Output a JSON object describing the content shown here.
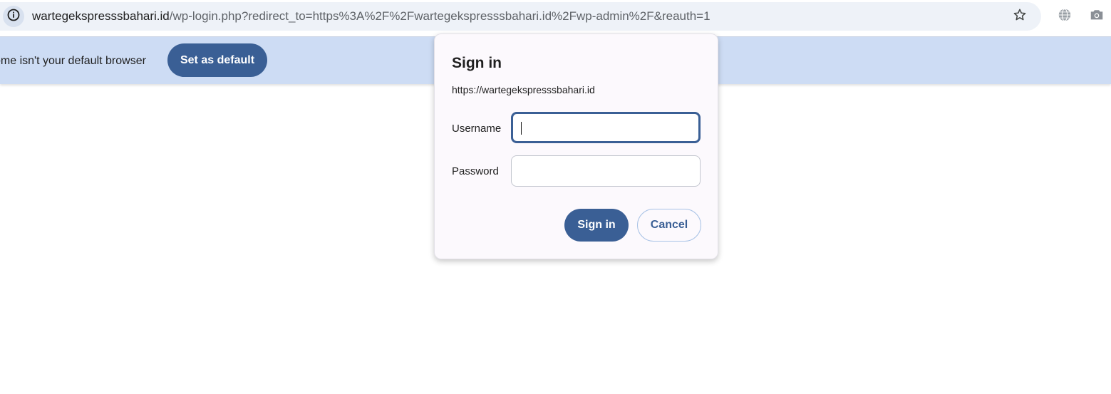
{
  "colors": {
    "accent": "#3a5f95",
    "infobar_bg": "#cddcf4",
    "omnibox_bg": "#eef2f8",
    "dialog_bg": "#fcf9fd"
  },
  "address_bar": {
    "site_info_icon": "info-icon",
    "url_host": "wartegekspresssbahari.id",
    "url_path": "/wp-login.php?redirect_to=https%3A%2F%2Fwartegekspresssbahari.id%2Fwp-admin%2F&reauth=1",
    "bookmark_icon": "star-icon",
    "extensions": [
      "globe-icon",
      "camera-icon"
    ]
  },
  "infobar": {
    "message": "ome isn't your default browser",
    "button_label": "Set as default"
  },
  "dialog": {
    "title": "Sign in",
    "origin": "https://wartegekspresssbahari.id",
    "username_label": "Username",
    "username_value": "",
    "password_label": "Password",
    "password_value": "",
    "signin_label": "Sign in",
    "cancel_label": "Cancel"
  }
}
